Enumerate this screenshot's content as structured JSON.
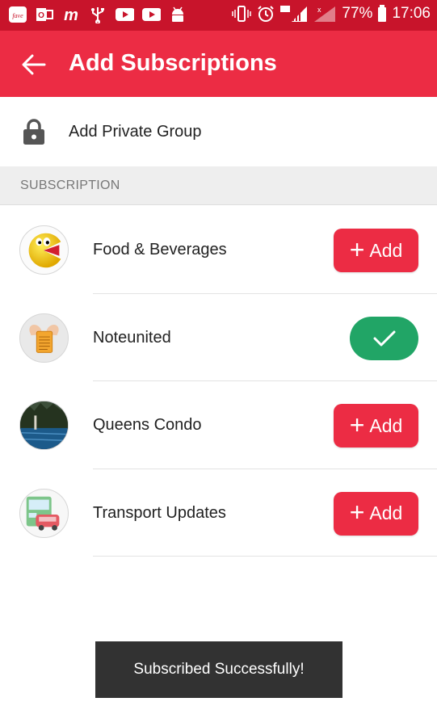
{
  "status_bar": {
    "left_icons": [
      "fave-icon",
      "outlook-icon",
      "m-app-icon",
      "usb-icon",
      "youtube-icon",
      "youtube-icon",
      "android-debug-icon"
    ],
    "right_icons": [
      "vibrate-icon",
      "alarm-icon",
      "signal-icon",
      "signal-weak-icon"
    ],
    "battery": "77%",
    "time": "17:06"
  },
  "app_bar": {
    "title": "Add Subscriptions",
    "color": "#ec2c44"
  },
  "private_group": {
    "label": "Add Private Group",
    "icon": "lock-icon"
  },
  "section": {
    "label": "SUBSCRIPTION"
  },
  "subscriptions": [
    {
      "name": "Food & Beverages",
      "avatar": "pacman-icon",
      "subscribed": false,
      "button_label": "Add"
    },
    {
      "name": "Noteunited",
      "avatar": "note-icon",
      "subscribed": true,
      "button_label": ""
    },
    {
      "name": "Queens Condo",
      "avatar": "pool-photo-icon",
      "subscribed": false,
      "button_label": "Add"
    },
    {
      "name": "Transport Updates",
      "avatar": "bus-icon",
      "subscribed": false,
      "button_label": "Add"
    }
  ],
  "toast": {
    "message": "Subscribed Successfully!"
  },
  "colors": {
    "status_bar": "#c8142b",
    "accent": "#ec2c44",
    "subscribed": "#21a566"
  }
}
